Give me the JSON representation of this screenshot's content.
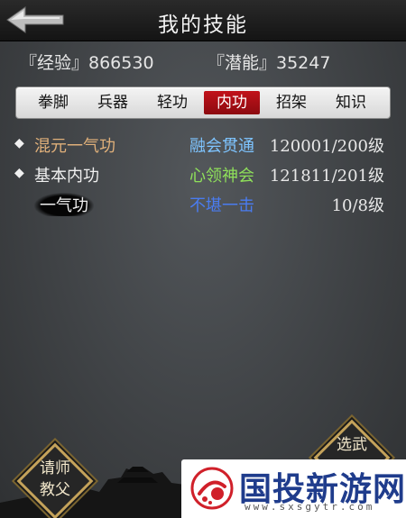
{
  "header": {
    "title": "我的技能",
    "back_icon": "back-arrow-icon"
  },
  "stats": {
    "experience": "『经验』866530",
    "potential": "『潜能』35247"
  },
  "tabs": [
    {
      "label": "拳脚",
      "active": false
    },
    {
      "label": "兵器",
      "active": false
    },
    {
      "label": "轻功",
      "active": false
    },
    {
      "label": "内功",
      "active": true
    },
    {
      "label": "招架",
      "active": false
    },
    {
      "label": "知识",
      "active": false
    }
  ],
  "skills": [
    {
      "marker": "◆",
      "name": "混元一气功",
      "rank": "融会贯通",
      "level": "120001/200级",
      "name_color": "#e0b07a",
      "rank_color": "#7ec4ff"
    },
    {
      "marker": "◆",
      "name": "基本内功",
      "rank": "心领神会",
      "level": "121811/201级",
      "name_color": "#f0f0f0",
      "rank_color": "#8fe05a"
    },
    {
      "marker": "",
      "name": "一气功",
      "rank": "不堪一击",
      "level": "10/8级",
      "name_color": "#f0f0f0",
      "rank_color": "#4a7cf0"
    }
  ],
  "buttons": {
    "teacher": "请师\n教父",
    "right": "选武"
  },
  "watermark": {
    "text": "国投新游网",
    "url": "www.sxsgytr.com"
  },
  "colors": {
    "active_tab": "#b0101a",
    "header_bg": "#1e1e1e",
    "button_gold": "#c4a25a"
  }
}
